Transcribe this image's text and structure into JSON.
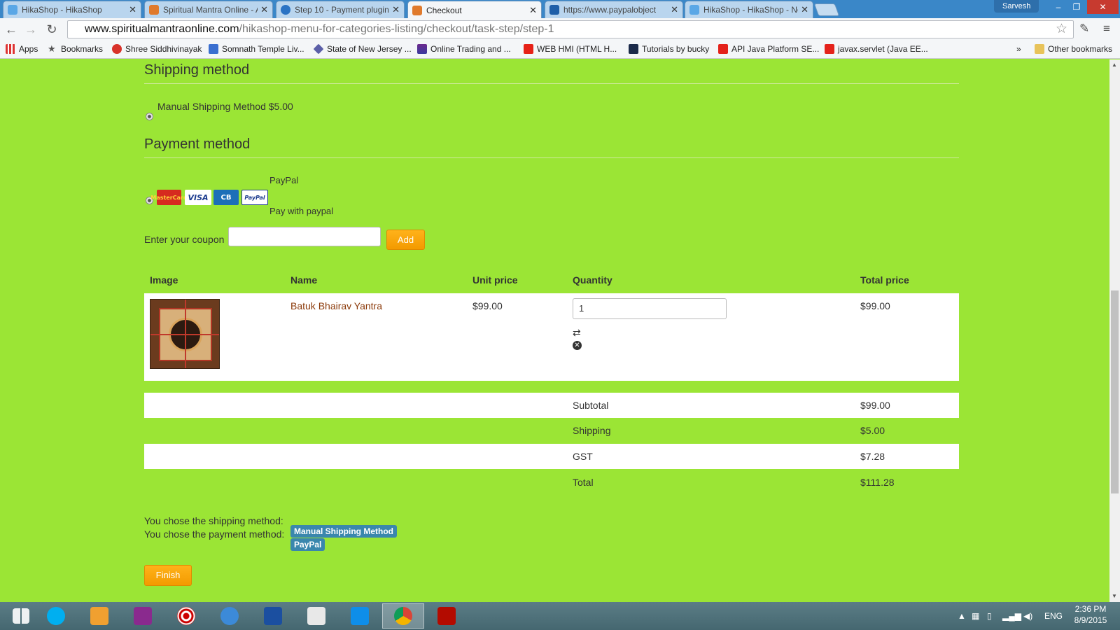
{
  "browser": {
    "tabs": [
      {
        "title": "HikaShop - HikaShop",
        "active": false
      },
      {
        "title": "Spiritual Mantra Online - A",
        "active": false
      },
      {
        "title": "Step 10 - Payment plugin:",
        "active": false
      },
      {
        "title": "Checkout",
        "active": true
      },
      {
        "title": "https://www.paypalobject",
        "active": false
      },
      {
        "title": "HikaShop - HikaShop - Ne",
        "active": false
      }
    ],
    "profile_name": "Sarvesh",
    "url_host": "www.spiritualmantraonline.com",
    "url_path": "/hikashop-menu-for-categories-listing/checkout/task-step/step-1",
    "bookmarks": [
      "Apps",
      "Bookmarks",
      "Shree Siddhivinayak",
      "Somnath Temple Liv...",
      "State of New Jersey ...",
      "Online Trading and ...",
      "WEB HMI (HTML H...",
      "Tutorials by bucky",
      "API Java Platform SE...",
      "javax.servlet (Java EE..."
    ],
    "more_bookmarks": "»",
    "other_bookmarks": "Other bookmarks"
  },
  "shipping": {
    "heading": "Shipping method",
    "option": "Manual Shipping Method $5.00"
  },
  "payment": {
    "heading": "Payment method",
    "name": "PayPal",
    "description": "Pay with paypal",
    "cards": [
      "MasterCard",
      "VISA",
      "CB",
      "PayPal"
    ]
  },
  "coupon": {
    "label": "Enter your coupon",
    "value": "",
    "button": "Add"
  },
  "cart": {
    "headers": {
      "image": "Image",
      "name": "Name",
      "unit_price": "Unit price",
      "quantity": "Quantity",
      "total_price": "Total price"
    },
    "items": [
      {
        "name": "Batuk Bhairav Yantra",
        "unit_price": "$99.00",
        "quantity": "1",
        "total": "$99.00"
      }
    ],
    "summary": [
      {
        "label": "Subtotal",
        "value": "$99.00"
      },
      {
        "label": "Shipping",
        "value": "$5.00"
      },
      {
        "label": "GST",
        "value": "$7.28"
      },
      {
        "label": "Total",
        "value": "$111.28"
      }
    ]
  },
  "confirmation": {
    "shipping_text": "You chose the shipping method:",
    "shipping_badge": "Manual Shipping Method",
    "payment_text": "You chose the payment method:",
    "payment_badge": "PayPal",
    "finish_button": "Finish"
  },
  "taskbar": {
    "language": "ENG",
    "time": "2:36 PM",
    "date": "8/9/2015"
  }
}
